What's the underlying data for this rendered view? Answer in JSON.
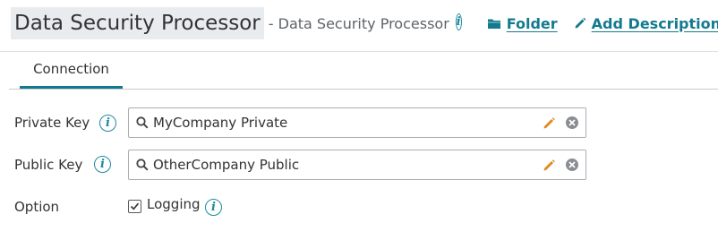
{
  "header": {
    "title": "Data Security Processor",
    "subtitle": "- Data Security Processor",
    "info_icon": "info-icon",
    "folder_label": "Folder",
    "add_description_label": "Add Description"
  },
  "tabs": [
    {
      "label": "Connection",
      "active": true
    }
  ],
  "form": {
    "private_key": {
      "label": "Private Key",
      "value": "MyCompany Private"
    },
    "public_key": {
      "label": "Public Key",
      "value": "OtherCompany Public"
    },
    "option": {
      "label": "Option",
      "checkbox_label": "Logging",
      "checked": true
    }
  },
  "colors": {
    "accent": "#137a8f",
    "info": "#1e8a9e",
    "edit_icon": "#e08a1e",
    "title_bg": "#e9ecef"
  }
}
